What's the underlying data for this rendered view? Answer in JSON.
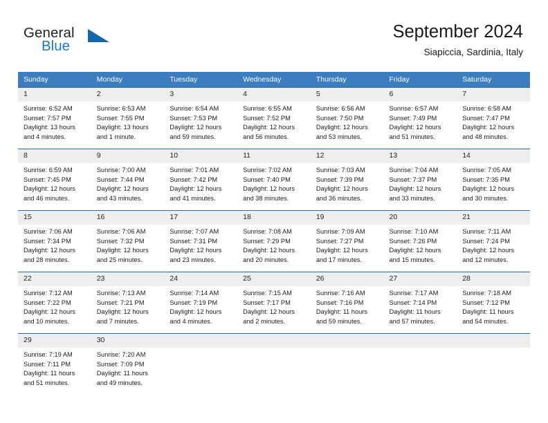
{
  "brand": {
    "name_part1": "General",
    "name_part2": "Blue",
    "flag_icon": "blue-triangle-flag-icon",
    "accent_color": "#1566ab"
  },
  "header": {
    "title": "September 2024",
    "subtitle": "Siapiccia, Sardinia, Italy"
  },
  "theme": {
    "header_bg": "#3b7dbf",
    "row_border": "#1f6db5",
    "daynum_bg": "#eeeeee",
    "text": "#1a1a1a"
  },
  "weekdays": [
    "Sunday",
    "Monday",
    "Tuesday",
    "Wednesday",
    "Thursday",
    "Friday",
    "Saturday"
  ],
  "weeks": [
    [
      {
        "day": "1",
        "sunrise": "Sunrise: 6:52 AM",
        "sunset": "Sunset: 7:57 PM",
        "daylight1": "Daylight: 13 hours",
        "daylight2": "and 4 minutes."
      },
      {
        "day": "2",
        "sunrise": "Sunrise: 6:53 AM",
        "sunset": "Sunset: 7:55 PM",
        "daylight1": "Daylight: 13 hours",
        "daylight2": "and 1 minute."
      },
      {
        "day": "3",
        "sunrise": "Sunrise: 6:54 AM",
        "sunset": "Sunset: 7:53 PM",
        "daylight1": "Daylight: 12 hours",
        "daylight2": "and 59 minutes."
      },
      {
        "day": "4",
        "sunrise": "Sunrise: 6:55 AM",
        "sunset": "Sunset: 7:52 PM",
        "daylight1": "Daylight: 12 hours",
        "daylight2": "and 56 minutes."
      },
      {
        "day": "5",
        "sunrise": "Sunrise: 6:56 AM",
        "sunset": "Sunset: 7:50 PM",
        "daylight1": "Daylight: 12 hours",
        "daylight2": "and 53 minutes."
      },
      {
        "day": "6",
        "sunrise": "Sunrise: 6:57 AM",
        "sunset": "Sunset: 7:49 PM",
        "daylight1": "Daylight: 12 hours",
        "daylight2": "and 51 minutes."
      },
      {
        "day": "7",
        "sunrise": "Sunrise: 6:58 AM",
        "sunset": "Sunset: 7:47 PM",
        "daylight1": "Daylight: 12 hours",
        "daylight2": "and 48 minutes."
      }
    ],
    [
      {
        "day": "8",
        "sunrise": "Sunrise: 6:59 AM",
        "sunset": "Sunset: 7:45 PM",
        "daylight1": "Daylight: 12 hours",
        "daylight2": "and 46 minutes."
      },
      {
        "day": "9",
        "sunrise": "Sunrise: 7:00 AM",
        "sunset": "Sunset: 7:44 PM",
        "daylight1": "Daylight: 12 hours",
        "daylight2": "and 43 minutes."
      },
      {
        "day": "10",
        "sunrise": "Sunrise: 7:01 AM",
        "sunset": "Sunset: 7:42 PM",
        "daylight1": "Daylight: 12 hours",
        "daylight2": "and 41 minutes."
      },
      {
        "day": "11",
        "sunrise": "Sunrise: 7:02 AM",
        "sunset": "Sunset: 7:40 PM",
        "daylight1": "Daylight: 12 hours",
        "daylight2": "and 38 minutes."
      },
      {
        "day": "12",
        "sunrise": "Sunrise: 7:03 AM",
        "sunset": "Sunset: 7:39 PM",
        "daylight1": "Daylight: 12 hours",
        "daylight2": "and 36 minutes."
      },
      {
        "day": "13",
        "sunrise": "Sunrise: 7:04 AM",
        "sunset": "Sunset: 7:37 PM",
        "daylight1": "Daylight: 12 hours",
        "daylight2": "and 33 minutes."
      },
      {
        "day": "14",
        "sunrise": "Sunrise: 7:05 AM",
        "sunset": "Sunset: 7:35 PM",
        "daylight1": "Daylight: 12 hours",
        "daylight2": "and 30 minutes."
      }
    ],
    [
      {
        "day": "15",
        "sunrise": "Sunrise: 7:06 AM",
        "sunset": "Sunset: 7:34 PM",
        "daylight1": "Daylight: 12 hours",
        "daylight2": "and 28 minutes."
      },
      {
        "day": "16",
        "sunrise": "Sunrise: 7:06 AM",
        "sunset": "Sunset: 7:32 PM",
        "daylight1": "Daylight: 12 hours",
        "daylight2": "and 25 minutes."
      },
      {
        "day": "17",
        "sunrise": "Sunrise: 7:07 AM",
        "sunset": "Sunset: 7:31 PM",
        "daylight1": "Daylight: 12 hours",
        "daylight2": "and 23 minutes."
      },
      {
        "day": "18",
        "sunrise": "Sunrise: 7:08 AM",
        "sunset": "Sunset: 7:29 PM",
        "daylight1": "Daylight: 12 hours",
        "daylight2": "and 20 minutes."
      },
      {
        "day": "19",
        "sunrise": "Sunrise: 7:09 AM",
        "sunset": "Sunset: 7:27 PM",
        "daylight1": "Daylight: 12 hours",
        "daylight2": "and 17 minutes."
      },
      {
        "day": "20",
        "sunrise": "Sunrise: 7:10 AM",
        "sunset": "Sunset: 7:26 PM",
        "daylight1": "Daylight: 12 hours",
        "daylight2": "and 15 minutes."
      },
      {
        "day": "21",
        "sunrise": "Sunrise: 7:11 AM",
        "sunset": "Sunset: 7:24 PM",
        "daylight1": "Daylight: 12 hours",
        "daylight2": "and 12 minutes."
      }
    ],
    [
      {
        "day": "22",
        "sunrise": "Sunrise: 7:12 AM",
        "sunset": "Sunset: 7:22 PM",
        "daylight1": "Daylight: 12 hours",
        "daylight2": "and 10 minutes."
      },
      {
        "day": "23",
        "sunrise": "Sunrise: 7:13 AM",
        "sunset": "Sunset: 7:21 PM",
        "daylight1": "Daylight: 12 hours",
        "daylight2": "and 7 minutes."
      },
      {
        "day": "24",
        "sunrise": "Sunrise: 7:14 AM",
        "sunset": "Sunset: 7:19 PM",
        "daylight1": "Daylight: 12 hours",
        "daylight2": "and 4 minutes."
      },
      {
        "day": "25",
        "sunrise": "Sunrise: 7:15 AM",
        "sunset": "Sunset: 7:17 PM",
        "daylight1": "Daylight: 12 hours",
        "daylight2": "and 2 minutes."
      },
      {
        "day": "26",
        "sunrise": "Sunrise: 7:16 AM",
        "sunset": "Sunset: 7:16 PM",
        "daylight1": "Daylight: 11 hours",
        "daylight2": "and 59 minutes."
      },
      {
        "day": "27",
        "sunrise": "Sunrise: 7:17 AM",
        "sunset": "Sunset: 7:14 PM",
        "daylight1": "Daylight: 11 hours",
        "daylight2": "and 57 minutes."
      },
      {
        "day": "28",
        "sunrise": "Sunrise: 7:18 AM",
        "sunset": "Sunset: 7:12 PM",
        "daylight1": "Daylight: 11 hours",
        "daylight2": "and 54 minutes."
      }
    ],
    [
      {
        "day": "29",
        "sunrise": "Sunrise: 7:19 AM",
        "sunset": "Sunset: 7:11 PM",
        "daylight1": "Daylight: 11 hours",
        "daylight2": "and 51 minutes."
      },
      {
        "day": "30",
        "sunrise": "Sunrise: 7:20 AM",
        "sunset": "Sunset: 7:09 PM",
        "daylight1": "Daylight: 11 hours",
        "daylight2": "and 49 minutes."
      },
      {
        "day": "",
        "sunrise": "",
        "sunset": "",
        "daylight1": "",
        "daylight2": ""
      },
      {
        "day": "",
        "sunrise": "",
        "sunset": "",
        "daylight1": "",
        "daylight2": ""
      },
      {
        "day": "",
        "sunrise": "",
        "sunset": "",
        "daylight1": "",
        "daylight2": ""
      },
      {
        "day": "",
        "sunrise": "",
        "sunset": "",
        "daylight1": "",
        "daylight2": ""
      },
      {
        "day": "",
        "sunrise": "",
        "sunset": "",
        "daylight1": "",
        "daylight2": ""
      }
    ]
  ]
}
